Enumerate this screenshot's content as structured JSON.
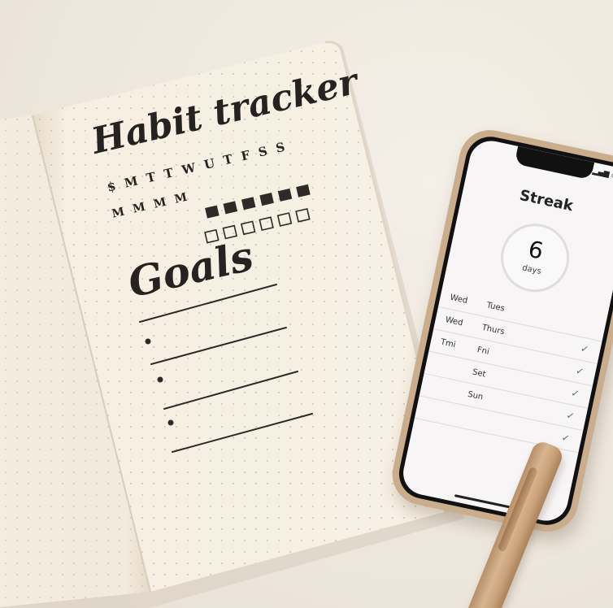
{
  "notebook": {
    "tracker_title": "Habit tracker",
    "goals_title": "Goals",
    "day_row_1": "$ M T T W U T F S S",
    "day_row_2": "M M M M"
  },
  "phone": {
    "title": "Streak",
    "streak_value": "6",
    "streak_unit": "days",
    "rows": [
      {
        "left": "Wed",
        "right": "Tues",
        "checked": false
      },
      {
        "left": "Wed",
        "right": "Thurs",
        "checked": true
      },
      {
        "left": "Tmi",
        "right": "Fni",
        "checked": true
      },
      {
        "left": "",
        "right": "Set",
        "checked": true
      },
      {
        "left": "",
        "right": "Sun",
        "checked": true
      },
      {
        "left": "",
        "right": "",
        "checked": true
      }
    ]
  },
  "colors": {
    "desk": "#efe9e0",
    "page": "#f6efe2",
    "ink": "#262220",
    "phone_frame": "#c9ad8c",
    "check": "#4a7a5a",
    "pen": "#c9a27a"
  }
}
